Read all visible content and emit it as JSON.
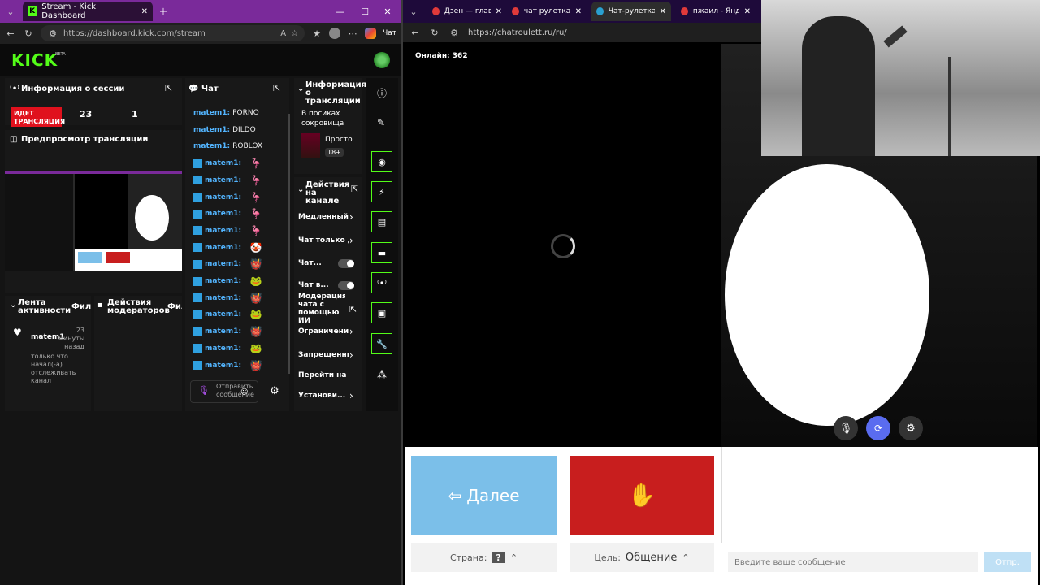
{
  "left": {
    "tab_title": "Stream - Kick Dashboard",
    "url": "https://dashboard.kick.com/stream",
    "right_tab_cut": "Чат",
    "logo": "KICK",
    "beta": "BETA",
    "session": {
      "title": "Информация о сессии",
      "status_badge": "ИДЕТ ТРАНСЛЯЦИЯ",
      "stat1": "23",
      "stat2": "1"
    },
    "preview_title": "Предпросмотр трансляции",
    "activity": {
      "title": "Лента активности",
      "filter": "Фильт",
      "user": "matem1",
      "time": "23 минуты назад",
      "message": "только что начал(-а) отслеживать канал"
    },
    "mod_actions": {
      "title": "Действия модераторов",
      "filter": "Фил"
    },
    "chat": {
      "title": "Чат",
      "username": "matem1:",
      "messages": [
        {
          "text": "PORNO",
          "emote": ""
        },
        {
          "text": "DILDO",
          "emote": ""
        },
        {
          "text": "ROBLOX",
          "emote": ""
        },
        {
          "text": "",
          "emote": "🦩"
        },
        {
          "text": "",
          "emote": "🦩"
        },
        {
          "text": "",
          "emote": "🦩"
        },
        {
          "text": "",
          "emote": "🦩"
        },
        {
          "text": "",
          "emote": "🦩"
        },
        {
          "text": "",
          "emote": "🤡"
        },
        {
          "text": "",
          "emote": "👹"
        },
        {
          "text": "",
          "emote": "🐸"
        },
        {
          "text": "",
          "emote": "👹"
        },
        {
          "text": "",
          "emote": "🐸"
        },
        {
          "text": "",
          "emote": "👹"
        },
        {
          "text": "",
          "emote": "🐸"
        },
        {
          "text": "",
          "emote": "👹"
        }
      ],
      "send_placeholder": "Отправить сообщение"
    },
    "stream_info": {
      "title": "Информация о трансляции",
      "stream_title": "В посиках сокровища",
      "category": "Просто",
      "age": "18+"
    },
    "channel_actions": {
      "title": "Действия на канале",
      "items": [
        "Медленный",
        "Чат только д",
        "Чат...",
        "Чат в...",
        "Модерация чата с помощью ИИ",
        "Ограничени",
        "Запрещенны",
        "Перейти на канал",
        "Установи..."
      ]
    }
  },
  "right": {
    "tabs": [
      "Дзен — главная с",
      "чат рулетка — Янд",
      "Чат-рулетка",
      "пжаил - Яндекс"
    ],
    "url": "https://chatroulett.ru/ru/",
    "online": "Онлайн: 362",
    "next_label": "Далее",
    "country_label": "Страна:",
    "country_value": "?",
    "goal_label": "Цель:",
    "goal_value": "Общение",
    "message_placeholder": "Введите ваше сообщение",
    "send_label": "Отпр."
  },
  "colors": {
    "kick_green": "#53fc18",
    "live_red": "#e0111d",
    "next_blue": "#7bbfe9",
    "stop_red": "#c81e1e"
  }
}
